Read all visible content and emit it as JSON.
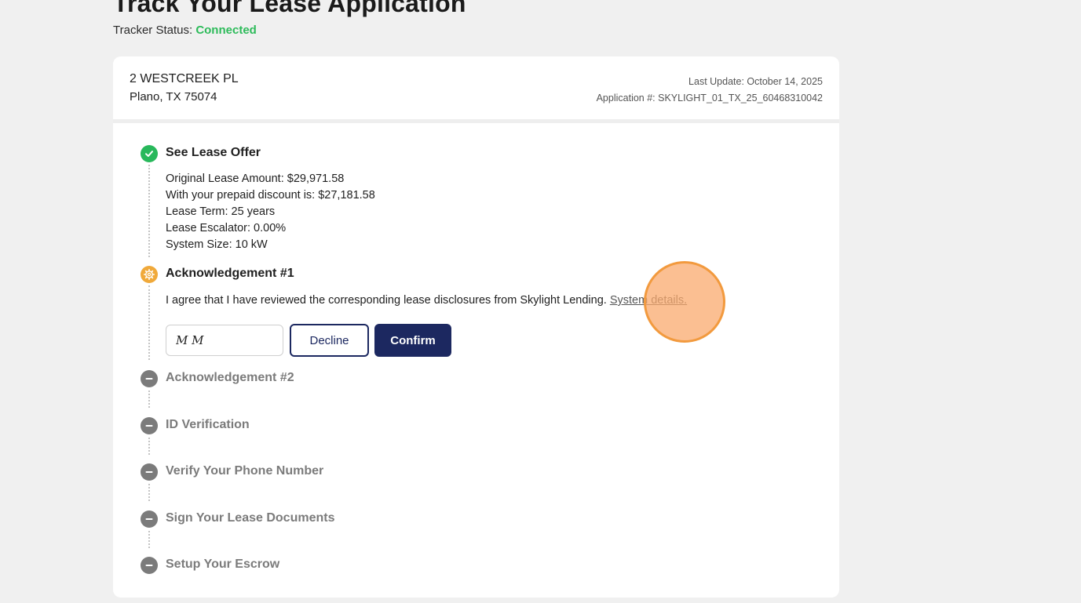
{
  "page": {
    "title": "Track Your Lease Application",
    "tracker_label": "Tracker Status:",
    "tracker_value": "Connected"
  },
  "colors": {
    "status_connected": "#2dbb5a",
    "step_done": "#28b85b",
    "step_active": "#f0a93a",
    "step_pending": "#7b7b7b",
    "primary_button": "#1c2860"
  },
  "card": {
    "address_line1": "2 WESTCREEK PL",
    "address_line2": "Plano, TX 75074",
    "last_update": "Last Update: October 14, 2025",
    "application_number": "Application #: SKYLIGHT_01_TX_25_60468310042"
  },
  "steps": [
    {
      "title": "See Lease Offer",
      "status": "done",
      "icon": "check-icon",
      "details": [
        "Original Lease Amount: $29,971.58",
        "With your prepaid discount is: $27,181.58",
        "Lease Term: 25 years",
        "Lease Escalator: 0.00%",
        "System Size: 10 kW"
      ]
    },
    {
      "title": "Acknowledgement #1",
      "status": "active",
      "icon": "gear-icon",
      "text": "I agree that I have reviewed the corresponding lease disclosures from Skylight Lending.",
      "link_text": "System details.",
      "input_value": "M M",
      "decline_label": "Decline",
      "confirm_label": "Confirm"
    },
    {
      "title": "Acknowledgement #2",
      "status": "pending",
      "icon": "minus-icon"
    },
    {
      "title": "ID Verification",
      "status": "pending",
      "icon": "minus-icon"
    },
    {
      "title": "Verify Your Phone Number",
      "status": "pending",
      "icon": "minus-icon"
    },
    {
      "title": "Sign Your Lease Documents",
      "status": "pending",
      "icon": "minus-icon"
    },
    {
      "title": "Setup Your Escrow",
      "status": "pending",
      "icon": "minus-icon"
    }
  ]
}
